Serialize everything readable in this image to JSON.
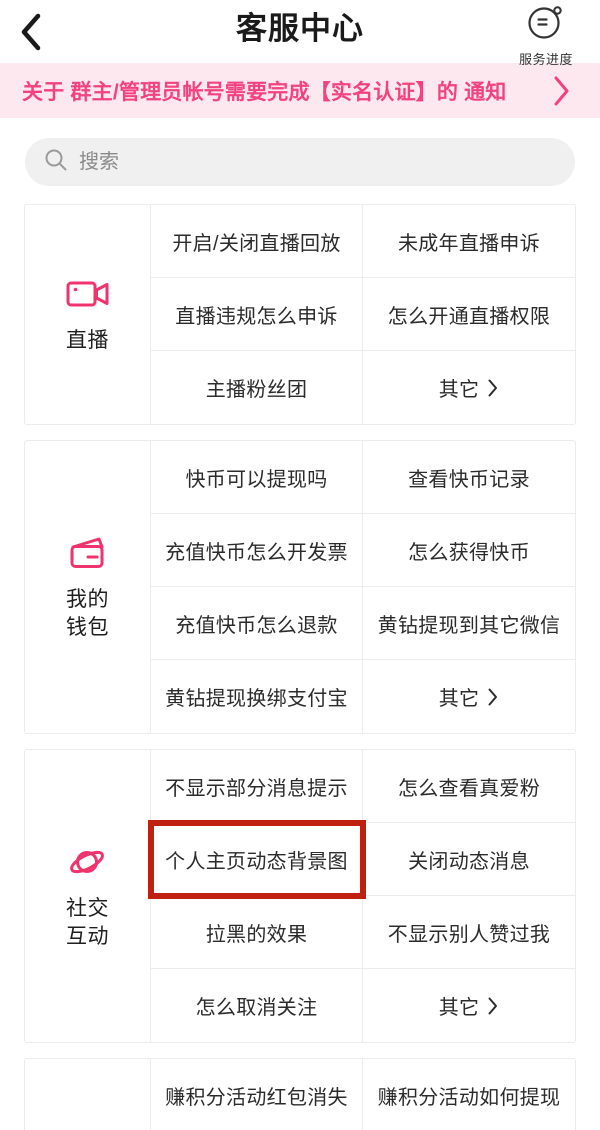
{
  "header": {
    "back_icon": "chevron-left-icon",
    "title": "客服中心",
    "service_progress_label": "服务进度",
    "service_progress_icon": "service-face-icon"
  },
  "notice": {
    "text": "关于 群主/管理员帐号需要完成【实名认证】的 通知",
    "chevron_icon": "chevron-right-icon",
    "background_color": "#fce8ee",
    "text_color": "#f2427f"
  },
  "search": {
    "placeholder": "搜索",
    "value": "",
    "icon": "search-icon"
  },
  "theme": {
    "accent": "#f2427f",
    "highlight_box": "#c0200f",
    "page_background": "#f7f7f7"
  },
  "categories": [
    {
      "id": "live",
      "label": "直播",
      "icon": "video-camera-icon",
      "items": [
        "开启/关闭直播回放",
        "未成年直播申诉",
        "直播违规怎么申诉",
        "怎么开通直播权限",
        "主播粉丝团",
        "其它"
      ],
      "more_label": "其它",
      "more_index": 5
    },
    {
      "id": "wallet",
      "label": "我的\n钱包",
      "label_lines": [
        "我的",
        "钱包"
      ],
      "icon": "wallet-icon",
      "items": [
        "快币可以提现吗",
        "查看快币记录",
        "充值快币怎么开发票",
        "怎么获得快币",
        "充值快币怎么退款",
        "黄钻提现到其它微信",
        "黄钻提现换绑支付宝",
        "其它"
      ],
      "more_label": "其它",
      "more_index": 7
    },
    {
      "id": "social",
      "label": "社交\n互动",
      "label_lines": [
        "社交",
        "互动"
      ],
      "icon": "planet-icon",
      "items": [
        "不显示部分消息提示",
        "怎么查看真爱粉",
        "个人主页动态背景图",
        "关闭动态消息",
        "拉黑的效果",
        "不显示别人赞过我",
        "怎么取消关注",
        "其它"
      ],
      "more_label": "其它",
      "more_index": 7,
      "highlighted_index": 2
    },
    {
      "id": "points",
      "label": "",
      "icon": "",
      "items": [
        "赚积分活动红包消失",
        "赚积分活动如何提现"
      ]
    }
  ]
}
